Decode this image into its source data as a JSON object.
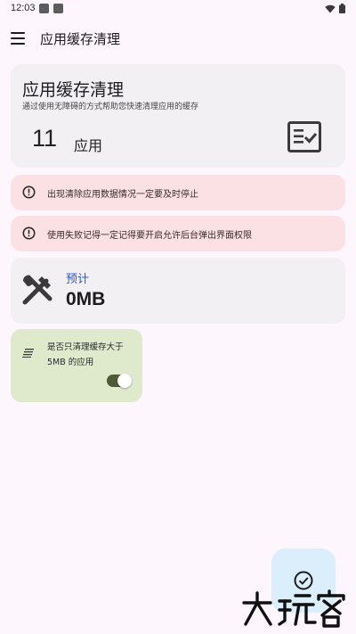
{
  "status_bar": {
    "time": "12:03"
  },
  "app_bar": {
    "title": "应用缓存清理"
  },
  "summary": {
    "title": "应用缓存清理",
    "description": "通过使用无障碍的方式帮助您快速清理应用的缓存",
    "count": "11",
    "unit": "应用"
  },
  "warnings": [
    {
      "text": "出现清除应用数据情况一定要及时停止"
    },
    {
      "text": "使用失败记得一定记得要开启允许后台弹出界面权限"
    }
  ],
  "estimate": {
    "label": "预计",
    "value": "0MB"
  },
  "filter": {
    "label": "是否只清理缓存大于 5MB 的应用",
    "enabled": true
  },
  "colors": {
    "background": "#fdf7fd",
    "card": "#f2f0f3",
    "warning": "#fbe1e3",
    "filter_card": "#dfe9cc",
    "accent_blue": "#2b56c6",
    "fab": "#dbeefb"
  },
  "icons": {
    "menu": "menu-icon",
    "checklist": "checklist-icon",
    "warning": "info-circle-icon",
    "tools": "tools-icon",
    "filter": "sort-lines-icon",
    "fab": "check-circle-icon"
  }
}
